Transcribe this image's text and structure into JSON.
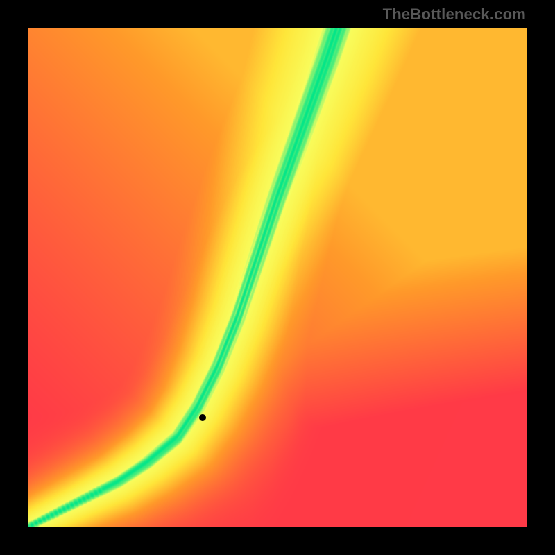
{
  "watermark": "TheBottleneck.com",
  "chart_data": {
    "type": "heatmap",
    "title": "",
    "xlabel": "",
    "ylabel": "",
    "xlim": [
      0,
      100
    ],
    "ylim": [
      0,
      100
    ],
    "grid": false,
    "legend": false,
    "crosshair": {
      "x": 35,
      "y": 22
    },
    "color_scale": [
      {
        "stop": 0.0,
        "color": "#ff3a47"
      },
      {
        "stop": 0.45,
        "color": "#ff9a2a"
      },
      {
        "stop": 0.7,
        "color": "#ffe63a"
      },
      {
        "stop": 0.85,
        "color": "#f8ff60"
      },
      {
        "stop": 1.0,
        "color": "#00e68a"
      }
    ],
    "ridge": [
      {
        "x": 0,
        "y": 0
      },
      {
        "x": 6,
        "y": 3
      },
      {
        "x": 12,
        "y": 6
      },
      {
        "x": 18,
        "y": 9
      },
      {
        "x": 24,
        "y": 13
      },
      {
        "x": 30,
        "y": 18
      },
      {
        "x": 34,
        "y": 24
      },
      {
        "x": 38,
        "y": 32
      },
      {
        "x": 42,
        "y": 42
      },
      {
        "x": 46,
        "y": 54
      },
      {
        "x": 50,
        "y": 66
      },
      {
        "x": 55,
        "y": 80
      },
      {
        "x": 60,
        "y": 94
      },
      {
        "x": 62,
        "y": 100
      }
    ],
    "ridge_width": 6,
    "background_corners": {
      "top_left_value": 0.0,
      "top_right_value": 0.52,
      "bottom_left_value": 0.0,
      "bottom_right_value": 0.0
    }
  }
}
